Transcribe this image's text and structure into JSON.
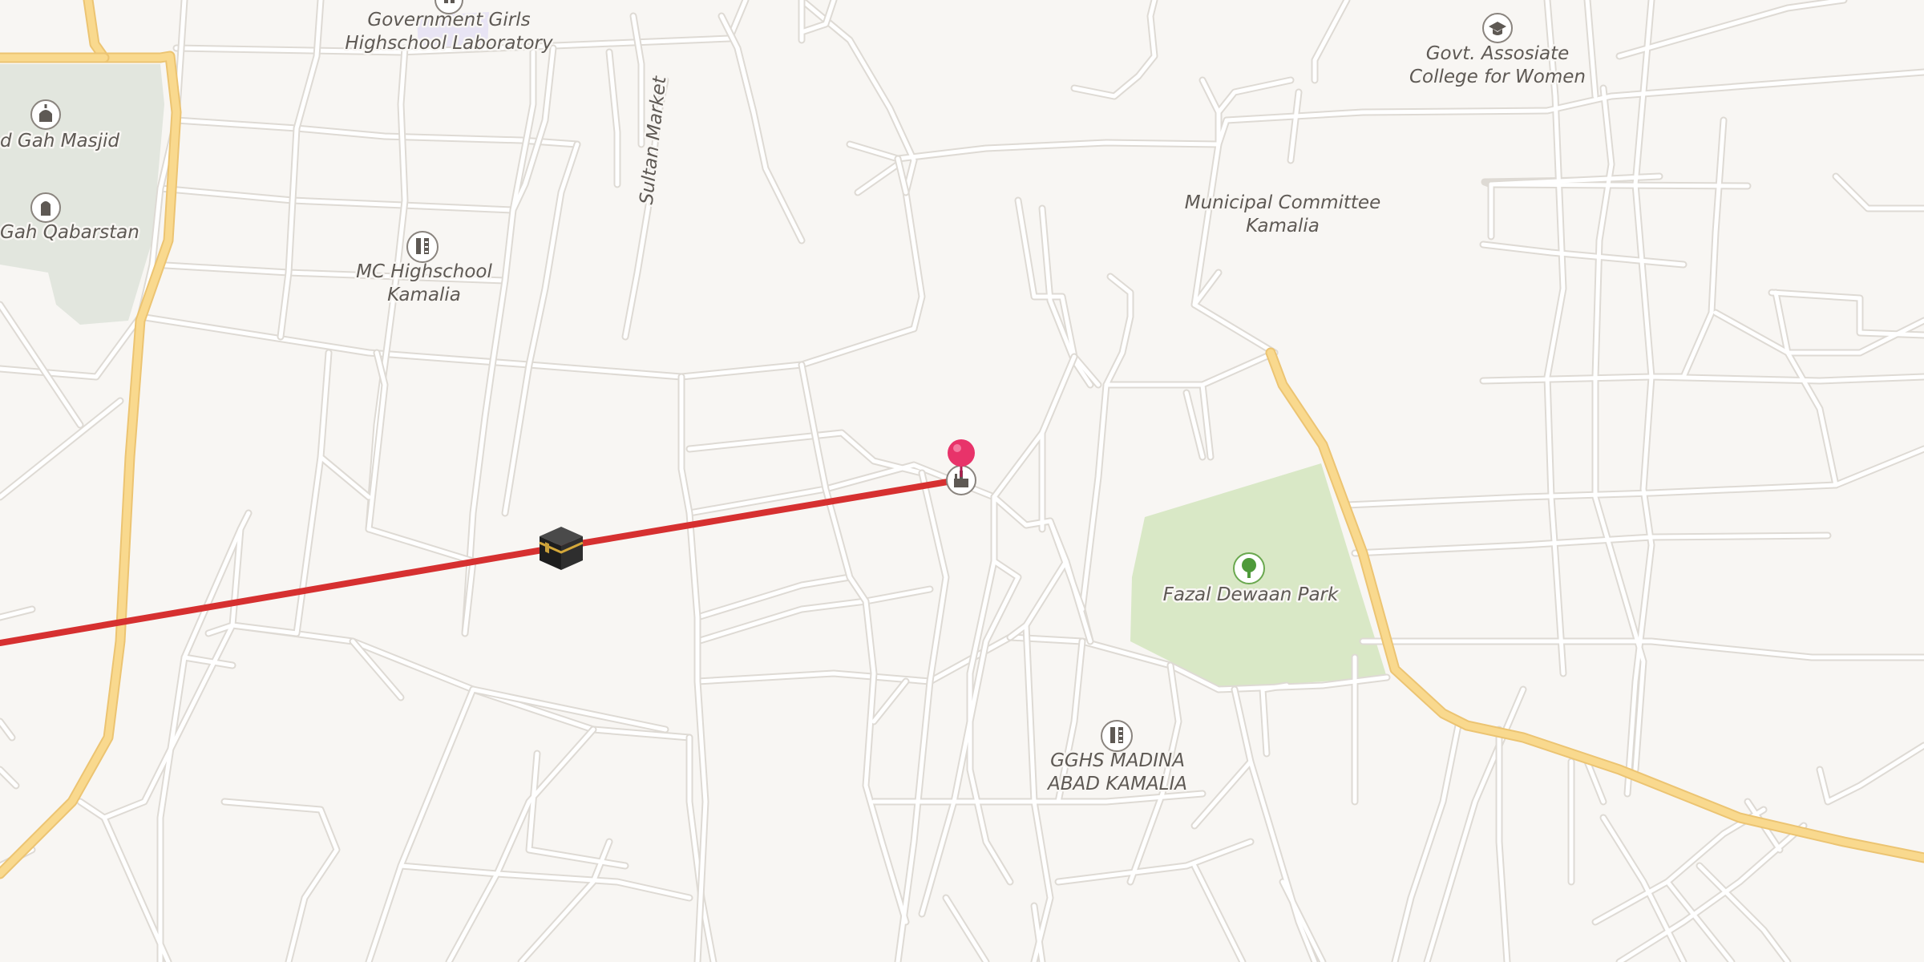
{
  "map": {
    "colors": {
      "background": "#f8f6f3",
      "minor_road": "#ffffff",
      "major_road": "#f9d98e",
      "park": "#d9e8c6",
      "cemetery": "#e2e6de",
      "school_area": "#e8e4f4",
      "route_line": "#d63030",
      "location_pin": "#e8336a"
    },
    "labels": {
      "govt_girls_lab_line1": "Government Girls",
      "govt_girls_lab_line2": "Highschool Laboratory",
      "govt_college_line1": "Govt. Assosiate",
      "govt_college_line2": "College for Women",
      "eid_gah_masjid": "d Gah Masjid",
      "eid_gah_qabarstan": "Gah Qabarstan",
      "sultan_market": "Sultan Market",
      "municipal_committee_line1": "Municipal Committee",
      "municipal_committee_line2": "Kamalia",
      "mc_highschool_line1": "MC Highschool",
      "mc_highschool_line2": "Kamalia",
      "fazal_dewaan_park": "Fazal Dewaan Park",
      "gghs_line1": "GGHS MADINA",
      "gghs_line2": "ABAD KAMALIA"
    },
    "icons": {
      "school_icon": "school-icon",
      "mosque_icon": "mosque-icon",
      "cemetery_icon": "cemetery-icon",
      "college_icon": "graduation-cap-icon",
      "park_icon": "tree-icon",
      "kaaba_icon": "kaaba-icon",
      "pin_icon": "location-pin-icon"
    }
  }
}
